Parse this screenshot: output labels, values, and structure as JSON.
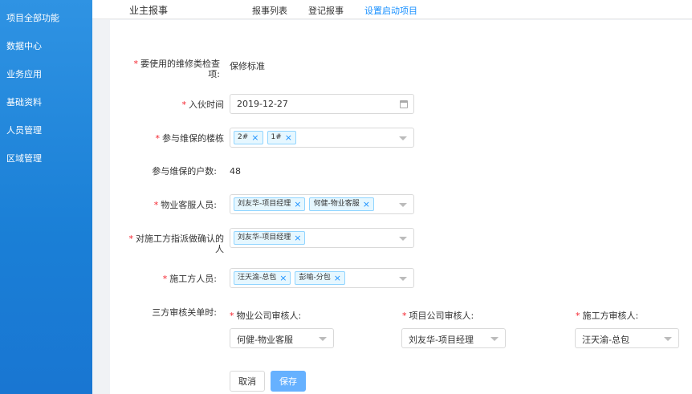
{
  "sidebar": {
    "items": [
      {
        "label": "项目全部功能"
      },
      {
        "label": "数据中心"
      },
      {
        "label": "业务应用"
      },
      {
        "label": "基础资料"
      },
      {
        "label": "人员管理"
      },
      {
        "label": "区域管理"
      }
    ]
  },
  "header": {
    "title": "业主报事",
    "tabs": [
      {
        "label": "报事列表",
        "active": false
      },
      {
        "label": "登记报事",
        "active": false
      },
      {
        "label": "设置启动项目",
        "active": true
      }
    ]
  },
  "form": {
    "required_mark": "*",
    "inspection_type": {
      "label_line1": "要使用的维修类检查",
      "label_line2": "项:",
      "value": "保修标准"
    },
    "move_in_date": {
      "label": "入伙时间",
      "value": "2019-12-27"
    },
    "buildings": {
      "label": "参与维保的楼栋",
      "tags": [
        "2#",
        "1#"
      ]
    },
    "households": {
      "label": "参与维保的户数:",
      "value": "48"
    },
    "property_staff": {
      "label": "物业客服人员:",
      "tags": [
        "刘友华-项目经理",
        "何健-物业客服"
      ]
    },
    "confirmer": {
      "label_line1": "对施工方指派做确认的",
      "label_line2": "人",
      "tags": [
        "刘友华-项目经理"
      ]
    },
    "construction_staff": {
      "label": "施工方人员:",
      "tags": [
        "汪天渝-总包",
        "彭喻-分包"
      ]
    },
    "audit": {
      "label": "三方审核关单时:",
      "property_reviewer": {
        "label": "物业公司审核人:",
        "value": "何健-物业客服"
      },
      "project_reviewer": {
        "label": "项目公司审核人:",
        "value": "刘友华-项目经理"
      },
      "construction_reviewer": {
        "label": "施工方审核人:",
        "value": "汪天渝-总包"
      }
    },
    "buttons": {
      "cancel": "取消",
      "save": "保存"
    }
  },
  "colors": {
    "sidebar": "#1a7fd6",
    "accent": "#1890ff",
    "required": "#f5222d",
    "save_button": "#66b1ff"
  },
  "icons": {
    "date": "calendar-icon",
    "dropdown": "chevron-down-icon",
    "tag_remove": "close-icon"
  }
}
